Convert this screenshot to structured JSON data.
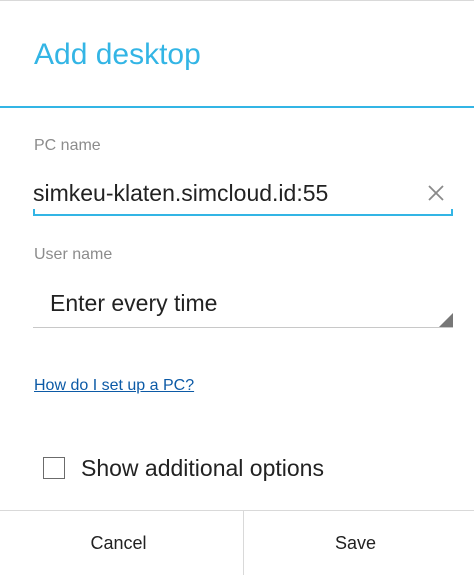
{
  "dialog": {
    "title": "Add desktop"
  },
  "pc_name": {
    "label": "PC name",
    "value": "simkeu-klaten.simcloud.id:55",
    "clear_icon": "close-icon"
  },
  "user_name": {
    "label": "User name",
    "selected": "Enter every time",
    "dropdown_icon": "spinner-triangle-icon"
  },
  "help_link": {
    "text": "How do I set up a PC?"
  },
  "options": {
    "checkbox_label": "Show additional options",
    "checked": false
  },
  "buttons": {
    "cancel": "Cancel",
    "save": "Save"
  },
  "colors": {
    "accent": "#33b5e5",
    "link": "#0c5aa6",
    "text": "#222222",
    "hint": "#8c8c8c",
    "divider": "#d9d9d9"
  }
}
